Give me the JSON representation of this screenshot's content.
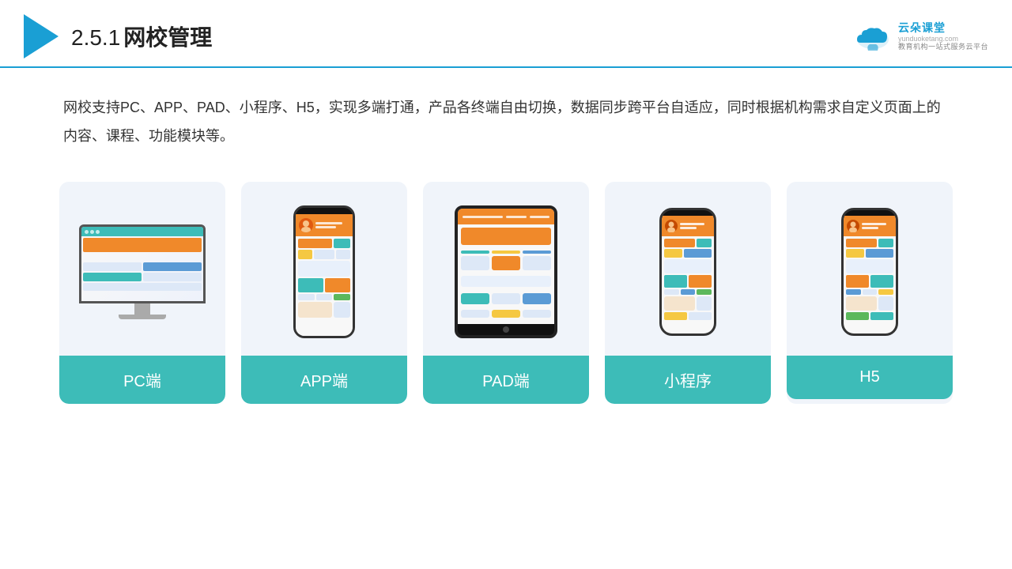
{
  "header": {
    "title": "网校管理",
    "number": "2.5.1",
    "logo_name": "云朵课堂",
    "logo_domain": "yunduoketang.com",
    "logo_tagline": "教育机构一站式服务云平台"
  },
  "description": {
    "text": "网校支持PC、APP、PAD、小程序、H5，实现多端打通，产品各终端自由切换，数据同步跨平台自适应，同时根据机构需求自定义页面上的内容、课程、功能模块等。"
  },
  "cards": [
    {
      "id": "pc",
      "label": "PC端"
    },
    {
      "id": "app",
      "label": "APP端"
    },
    {
      "id": "pad",
      "label": "PAD端"
    },
    {
      "id": "miniprogram",
      "label": "小程序"
    },
    {
      "id": "h5",
      "label": "H5"
    }
  ],
  "colors": {
    "accent": "#1a9fd4",
    "teal": "#3dbcb8",
    "orange": "#f0892a",
    "card_bg": "#f0f4fa"
  }
}
